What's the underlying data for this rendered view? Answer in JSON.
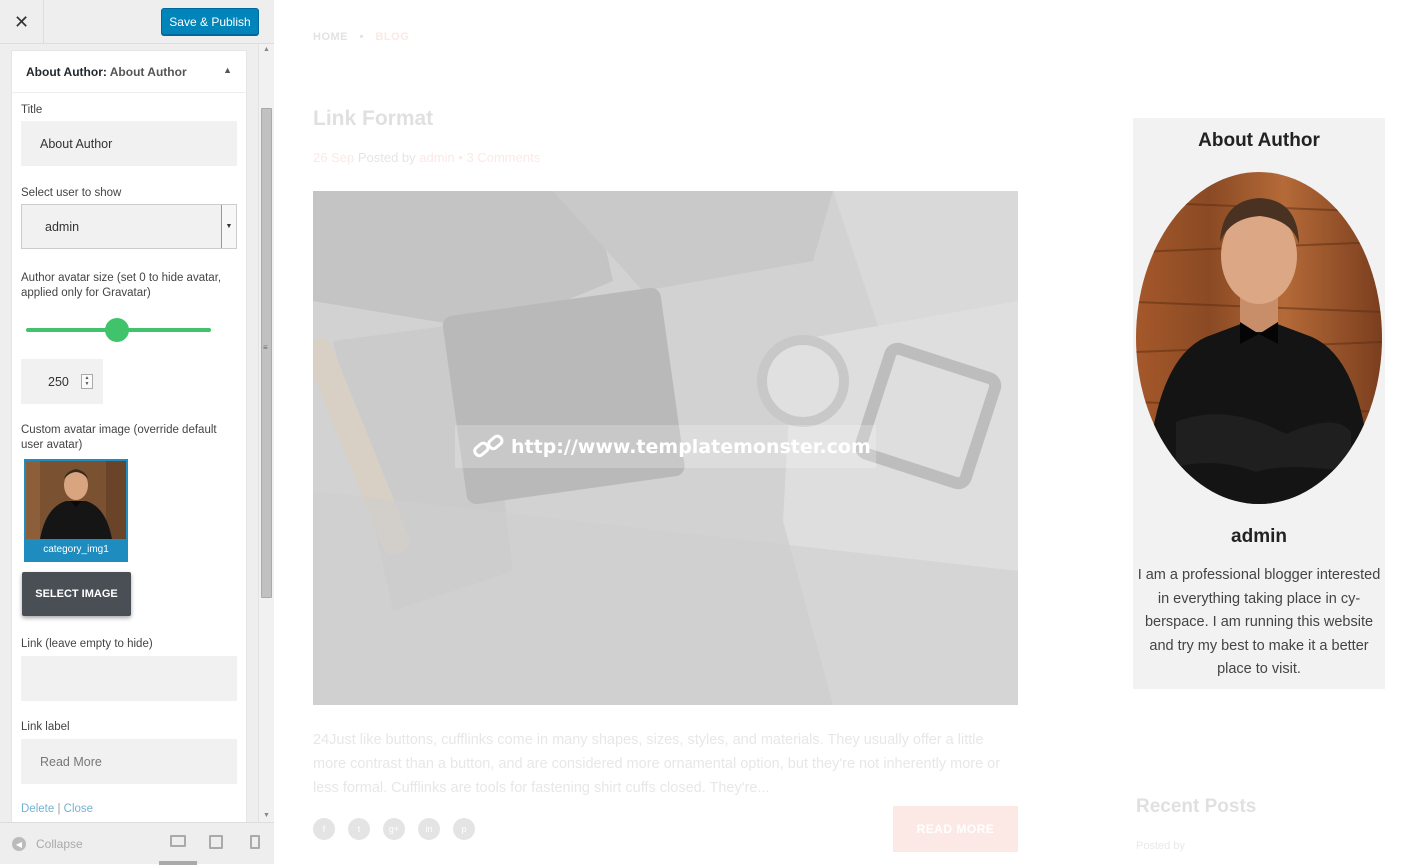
{
  "customizer": {
    "close_label": "✕",
    "save_label": "Save & Publish",
    "widget_title_prefix": "About Author:",
    "widget_title_name": "About Author",
    "fields": {
      "title_label": "Title",
      "title_value": "About Author",
      "user_label": "Select user to show",
      "user_value": "admin",
      "avatar_size_label": "Author avatar size (set 0 to hide avatar, applied only for Gravatar)",
      "avatar_size_value": "250",
      "avatar_size_slider_fraction": 0.49,
      "custom_avatar_label": "Custom avatar image (override default user avatar)",
      "custom_avatar_name": "category_img1",
      "select_image_label": "SELECT IMAGE",
      "link_label": "Link (leave empty to hide)",
      "link_value": "",
      "link_label_label": "Link label",
      "link_label_placeholder": "Read More"
    },
    "delete_label": "Delete",
    "separator": "|",
    "close_link_label": "Close",
    "collapse_label": "Collapse"
  },
  "preview": {
    "breadcrumb": {
      "home": "HOME",
      "separator": "•",
      "current": "BLOG"
    },
    "post": {
      "title": "Link Format",
      "date": "26 Sep",
      "posted_by": "Posted by",
      "author": "admin",
      "dot": "•",
      "comments": "3 Comments",
      "link_url": "http://www.templatemonster.com",
      "excerpt": "24Just like buttons, cufflinks come in many shapes, sizes, styles, and materials. They usually offer a little more contrast than a button, and are considered more ornamental option, but they're not inherently more or less formal. Cufflinks are tools for fastening shirt cuffs closed. They're...",
      "read_more": "READ MORE",
      "socials": [
        "f",
        "t",
        "g+",
        "in",
        "p"
      ]
    },
    "about_widget": {
      "title": "About Author",
      "name": "admin",
      "bio": "I am a professional blogger interested in everything taking place in cy-berspace. I am running this website and try my best to make it a better place to visit."
    },
    "recent_posts": {
      "title": "Recent Posts",
      "subtitle": "Posted by"
    }
  },
  "colors": {
    "accent": "#e34f3b",
    "primary_button": "#0085ba",
    "slider": "#40c36a",
    "select_image_btn": "#4a4f55"
  }
}
